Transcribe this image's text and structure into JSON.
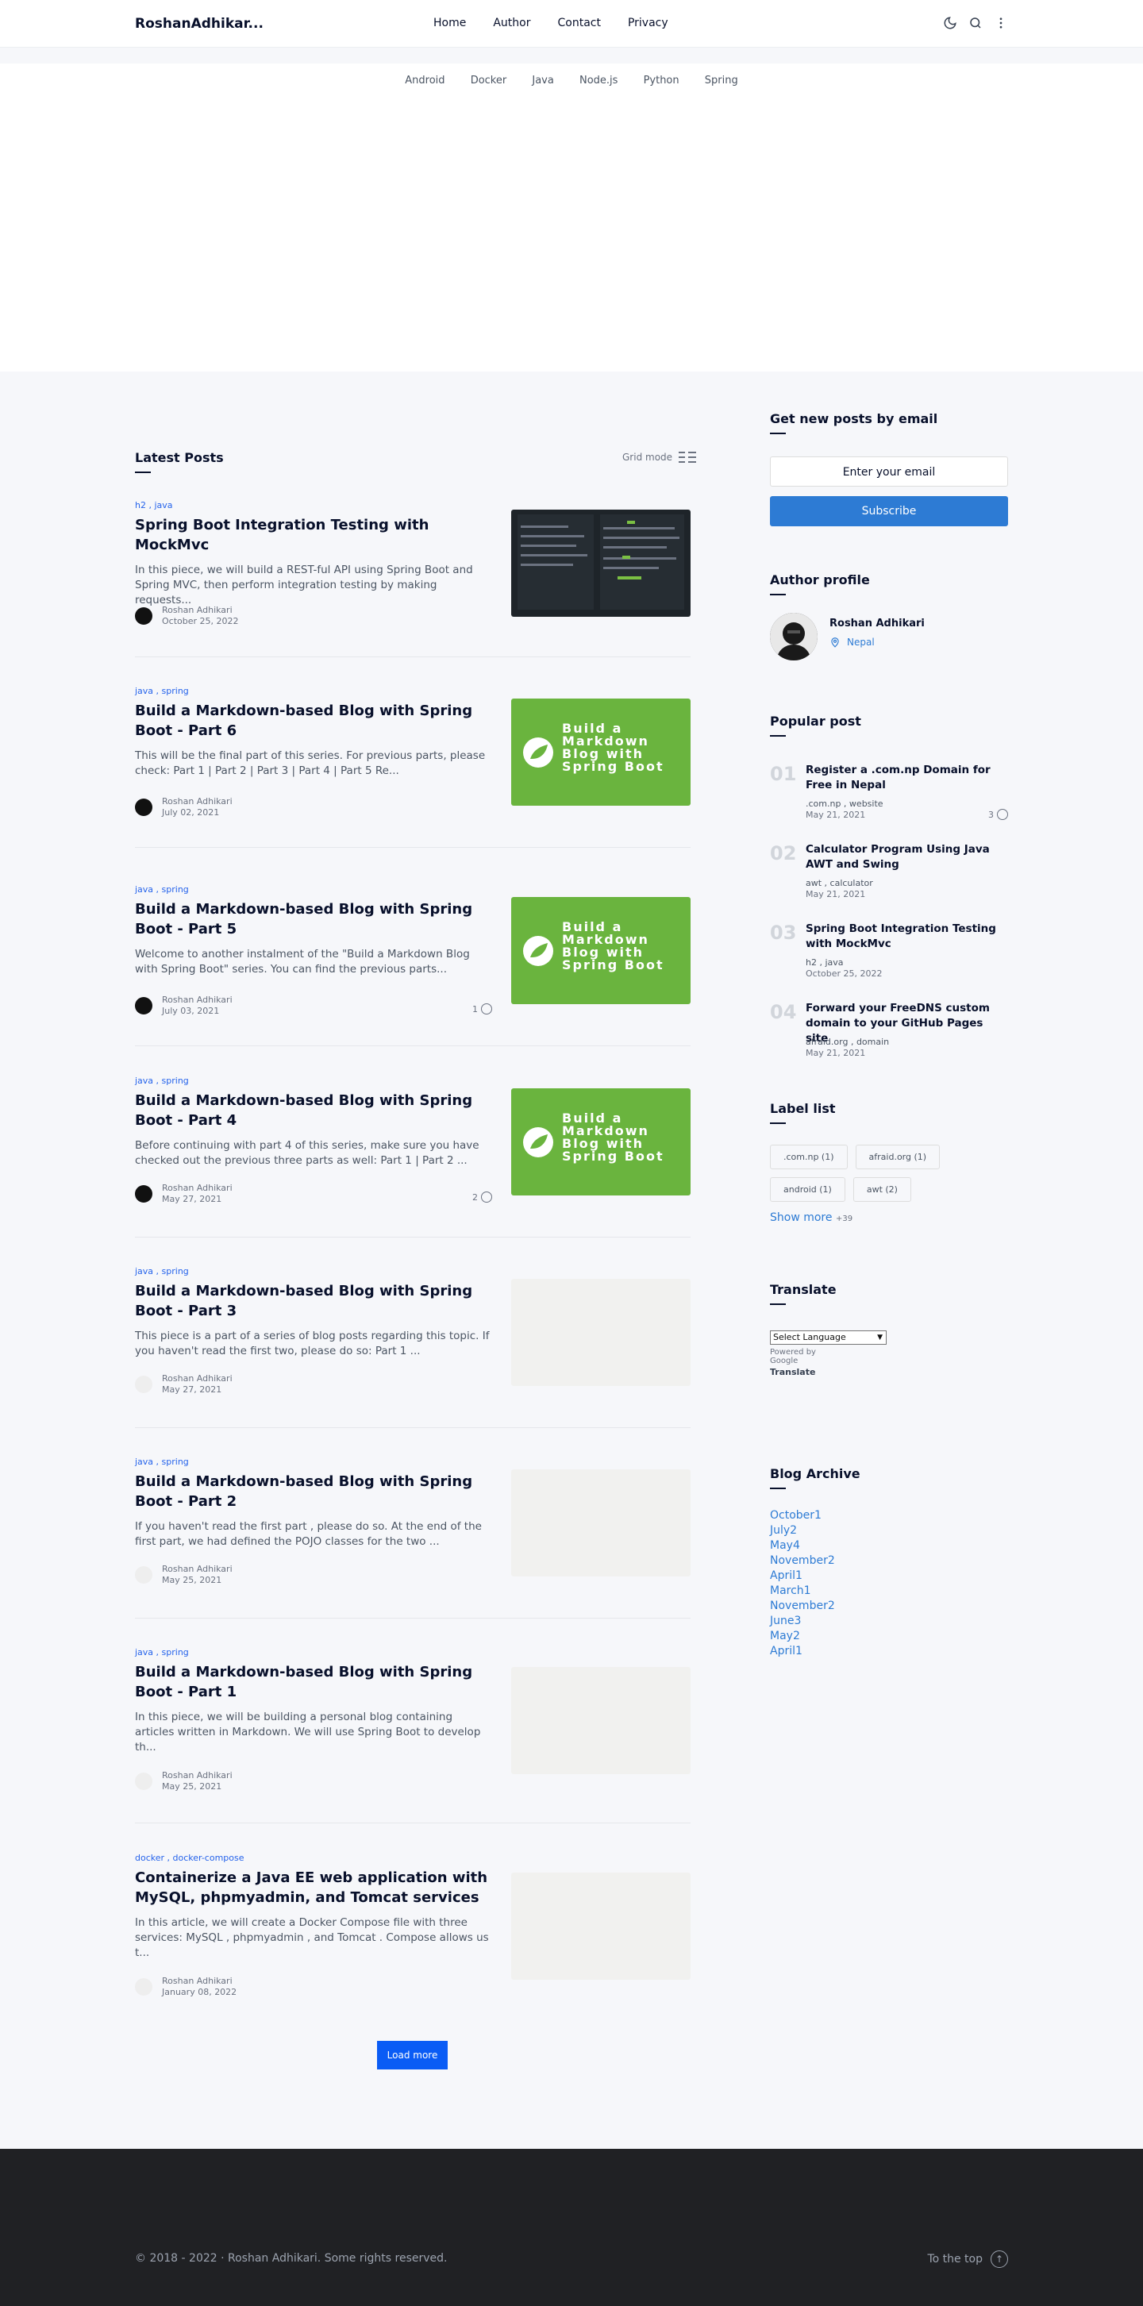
{
  "header": {
    "logo": "RoshanAdhikar...",
    "nav": [
      "Home",
      "Author",
      "Contact",
      "Privacy"
    ]
  },
  "categories": [
    "Android",
    "Docker",
    "Java",
    "Node.js",
    "Python",
    "Spring"
  ],
  "latest": {
    "title": "Latest Posts",
    "grid_mode": "Grid mode",
    "posts": [
      {
        "labels": "h2 , java",
        "title": "Spring Boot Integration Testing with MockMvc",
        "snippet": "In this piece, we will build a REST-ful API using Spring Boot and Spring MVC, then perform integration testing by making requests...",
        "author": "Roshan Adhikari",
        "date": "October 25, 2022",
        "comments": ""
      },
      {
        "labels": "java , spring",
        "title": "Build a Markdown-based Blog with Spring Boot - Part 6",
        "snippet": "This will be the final part of this series. For previous parts, please check: Part 1 | Part 2 | Part 3 | Part 4 | Part 5 Re...",
        "author": "Roshan Adhikari",
        "date": "July 02, 2021",
        "comments": ""
      },
      {
        "labels": "java , spring",
        "title": "Build a Markdown-based Blog with Spring Boot - Part 5",
        "snippet": "Welcome to another instalment of the \"Build a Markdown Blog with Spring Boot\" series. You can find the previous parts...",
        "author": "Roshan Adhikari",
        "date": "July 03, 2021",
        "comments": "1"
      },
      {
        "labels": "java , spring",
        "title": "Build a Markdown-based Blog with Spring Boot - Part 4",
        "snippet": "Before continuing with part 4 of this series, make sure you have checked out the previous three parts as well:  Part 1 | Part 2 ...",
        "author": "Roshan Adhikari",
        "date": "May 27, 2021",
        "comments": "2"
      },
      {
        "labels": "java , spring",
        "title": "Build a Markdown-based Blog with Spring Boot - Part 3",
        "snippet": "This piece is a part of a series of blog posts regarding this topic. If you haven't read the first two, please do so: Part 1 ...",
        "author": "Roshan Adhikari",
        "date": "May 27, 2021",
        "comments": ""
      },
      {
        "labels": "java , spring",
        "title": "Build a Markdown-based Blog with Spring Boot - Part 2",
        "snippet": "If you haven't read the first part , please do so. At the end of the first part, we had defined the POJO classes for the two ...",
        "author": "Roshan Adhikari",
        "date": "May 25, 2021",
        "comments": ""
      },
      {
        "labels": "java , spring",
        "title": "Build a Markdown-based Blog with Spring Boot - Part 1",
        "snippet": "In this piece, we will be building a personal blog containing articles written in Markdown. We will use Spring Boot to develop th...",
        "author": "Roshan Adhikari",
        "date": "May 25, 2021",
        "comments": ""
      },
      {
        "labels": "docker , docker-compose",
        "title": "Containerize a Java EE web application with MySQL, phpmyadmin, and Tomcat services",
        "snippet": "In this article, we will create a Docker Compose  file with three services: MySQL , phpmyadmin , and Tomcat . Compose allows us t...",
        "author": "Roshan Adhikari",
        "date": "January 08, 2022",
        "comments": ""
      }
    ],
    "thumb_text": "Build a Markdown Blog with Spring Boot",
    "load_more": "Load more"
  },
  "sidebar": {
    "email_title": "Get new posts by email",
    "email_placeholder": "Enter your email",
    "subscribe": "Subscribe",
    "author_title": "Author profile",
    "author_name": "Roshan Adhikari",
    "author_location": "Nepal",
    "popular_title": "Popular post",
    "popular": [
      {
        "num": "01",
        "title": "Register a .com.np Domain for Free in Nepal",
        "labels": ".com.np , website",
        "date": "May 21, 2021",
        "comments": "3"
      },
      {
        "num": "02",
        "title": "Calculator Program Using Java AWT and Swing",
        "labels": "awt , calculator",
        "date": "May 21, 2021",
        "comments": ""
      },
      {
        "num": "03",
        "title": "Spring Boot Integration Testing with MockMvc",
        "labels": "h2 , java",
        "date": "October 25, 2022",
        "comments": ""
      },
      {
        "num": "04",
        "title": "Forward your FreeDNS custom domain to your GitHub Pages site",
        "labels": "afraid.org , domain",
        "date": "May 21, 2021",
        "comments": ""
      }
    ],
    "labels_title": "Label list",
    "labels": [
      ".com.np   (1)",
      "afraid.org   (1)",
      "android   (1)",
      "awt   (2)"
    ],
    "show_more": "Show more",
    "show_more_count": "+39",
    "translate_title": "Translate",
    "select_language": "Select Language",
    "powered_by": "Powered by",
    "google": "Google",
    "translate": "Translate",
    "archive_title": "Blog Archive",
    "archive": [
      "October1",
      "July2",
      "May4",
      "November2",
      "April1",
      "March1",
      "November2",
      "June3",
      "May2",
      "April1"
    ]
  },
  "footer": {
    "copyright": "© 2018 - 2022 · Roshan Adhikari. Some rights reserved.",
    "to_top": "To the top"
  }
}
